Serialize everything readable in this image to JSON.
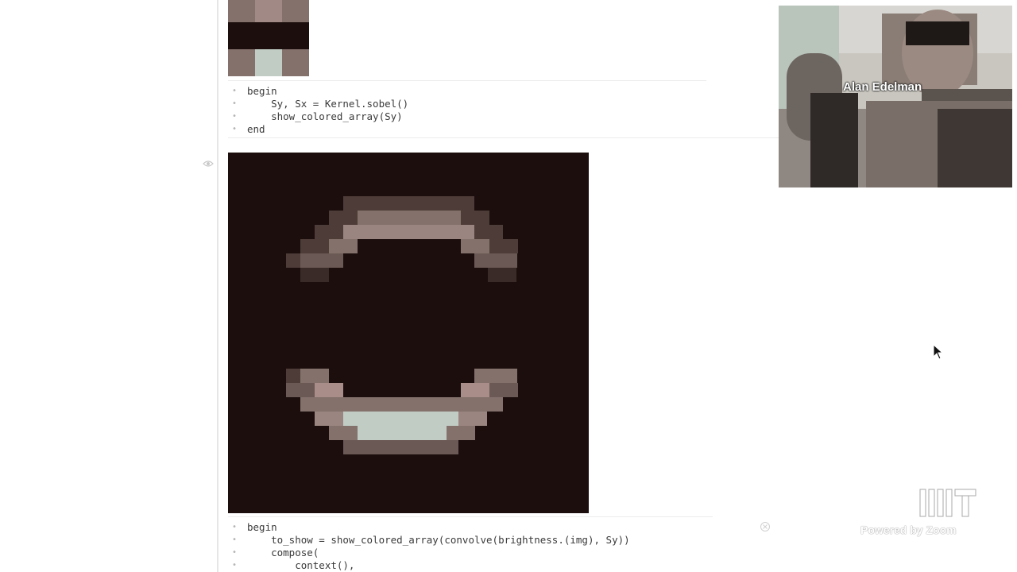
{
  "notebook": {
    "cells": [
      {
        "id": "sobel-cell",
        "lines": [
          "begin",
          "    Sy, Sx = Kernel.sobel()",
          "    show_colored_array(Sy)",
          "end"
        ]
      },
      {
        "id": "convolve-cell",
        "lines": [
          "begin",
          "    to_show = show_colored_array(convolve(brightness.(img), Sy))",
          "    compose(",
          "        context(),"
        ]
      }
    ]
  },
  "video": {
    "speaker_name": "Alan Edelman"
  },
  "branding": {
    "powered_by": "Powered by Zoom"
  },
  "icons": {
    "eye": "eye-icon",
    "cursor": "mouse-cursor-icon",
    "close": "close-cell-icon",
    "logo": "mit-logo-icon"
  },
  "colors": {
    "kernel_dark": "#1b0e0c",
    "kernel_mid": "#84716c",
    "kernel_light": "#c1cdc4",
    "kernel_edge": "#a88d88"
  }
}
